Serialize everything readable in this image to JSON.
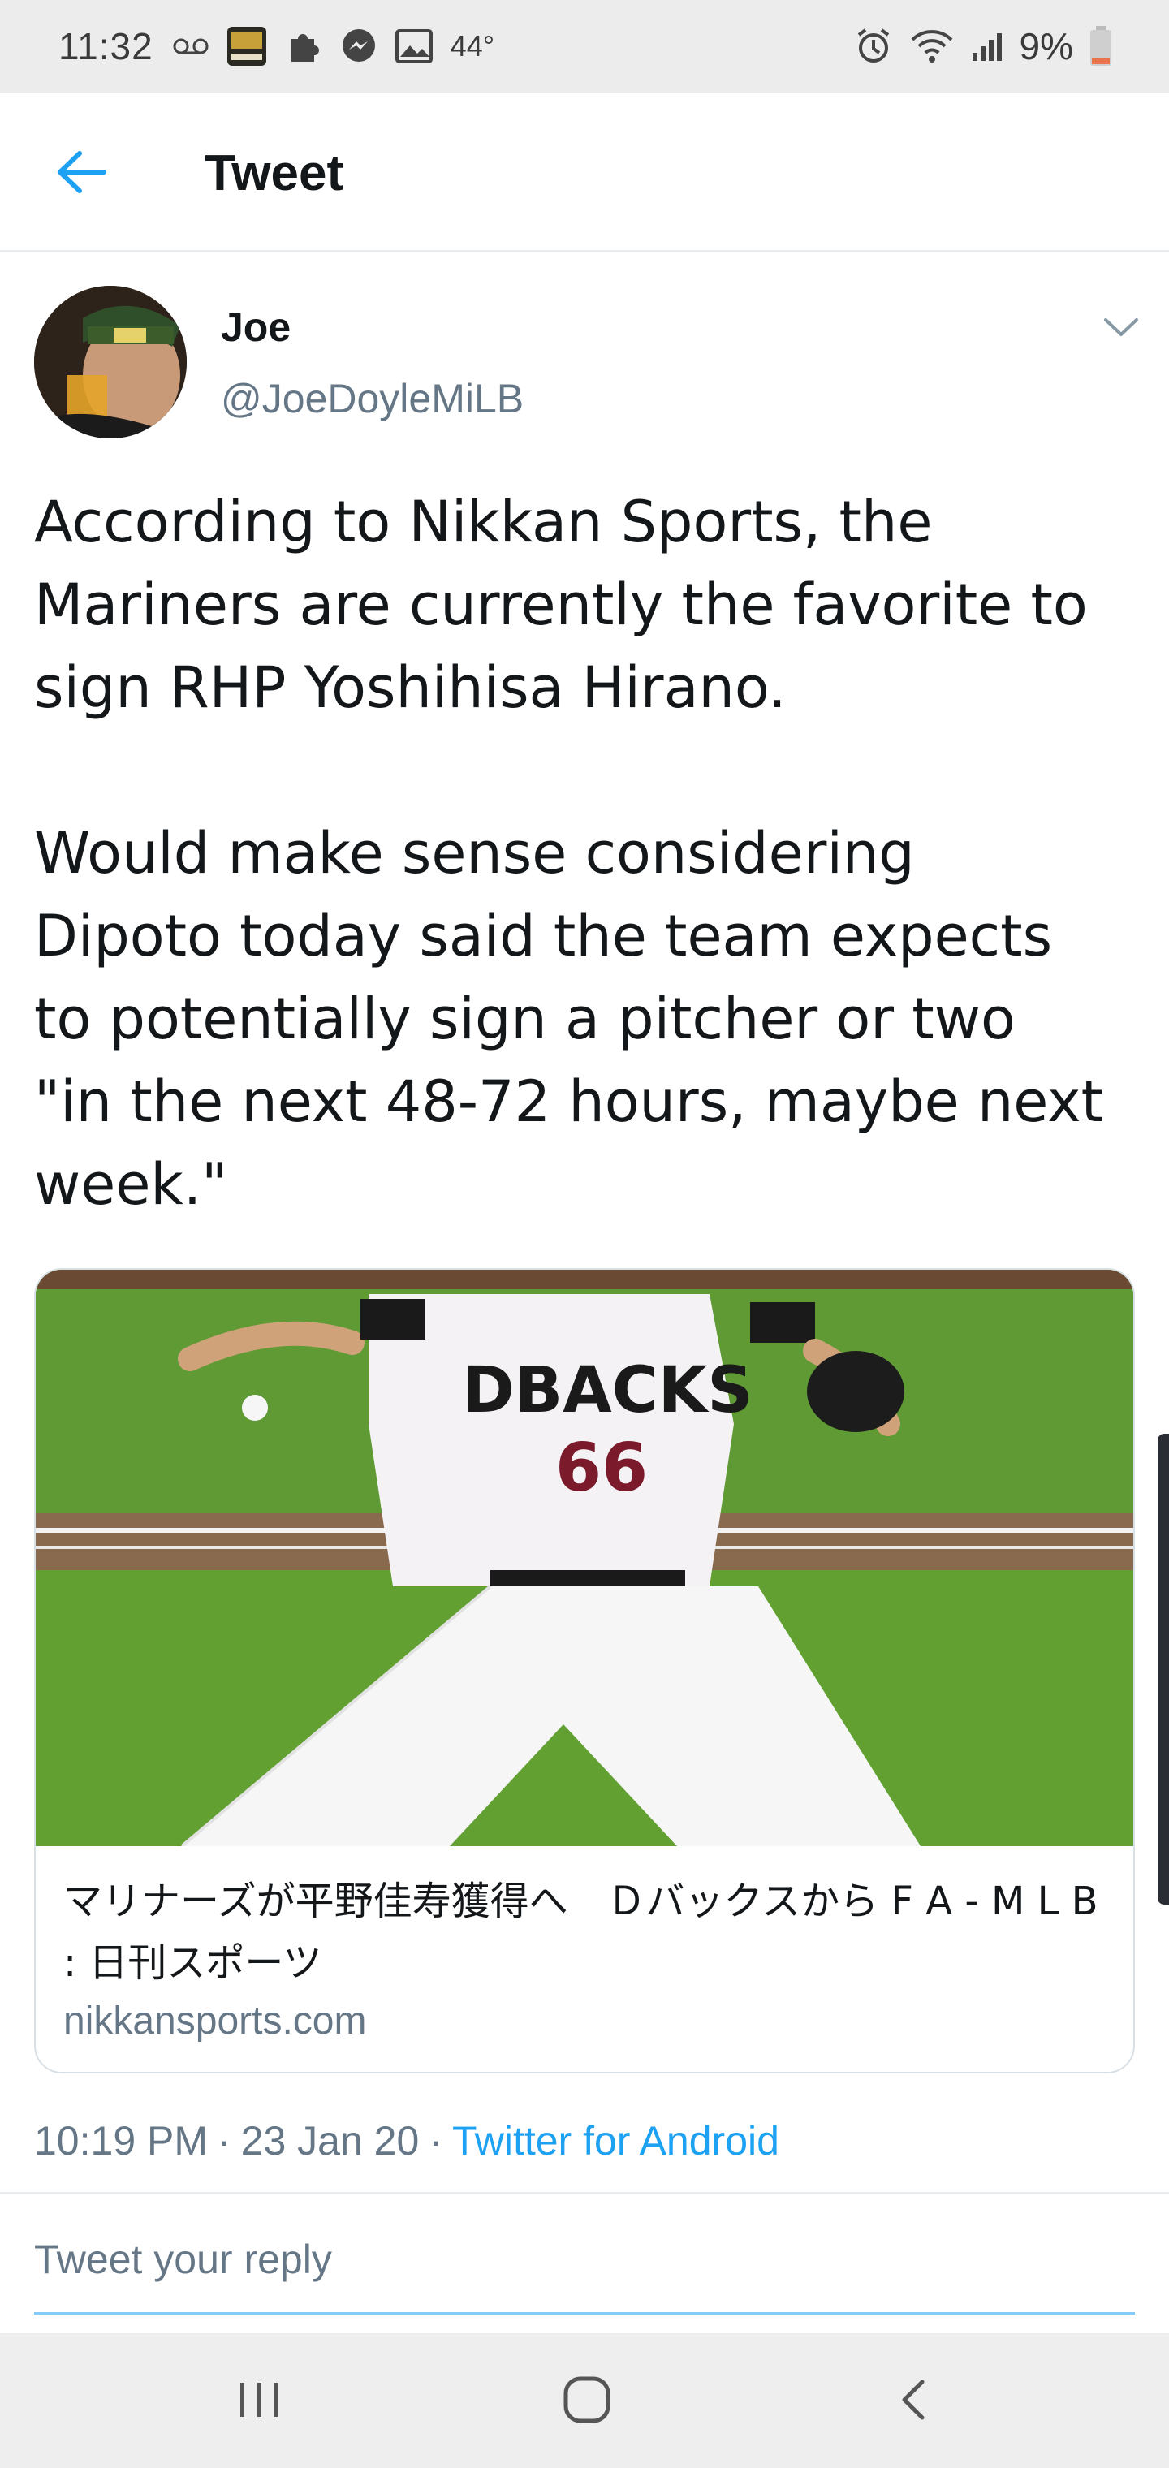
{
  "status_bar": {
    "time": "11:32",
    "temperature": "44°",
    "battery": "9%"
  },
  "header": {
    "title": "Tweet"
  },
  "tweet": {
    "author_name": "Joe",
    "author_handle": "@JoeDoyleMiLB",
    "text": "According to Nikkan Sports, the\nMariners are currently the favorite to\nsign RHP Yoshihisa Hirano.\n\nWould make sense considering\nDipoto today said the team expects\nto potentially sign a pitcher or two\n\"in the next 48-72 hours, maybe next\nweek.\"",
    "card": {
      "caption": "マリナーズが平野佳寿獲得へ　Ｄバックスから F A - M L B : 日刊スポーツ",
      "domain": "nikkansports.com",
      "image_jersey_text": "DBACKS",
      "image_jersey_number": "66"
    },
    "time": "10:19 PM",
    "date": "23 Jan 20",
    "separator": "·",
    "source": "Twitter for Android"
  },
  "reply": {
    "placeholder": "Tweet your reply"
  },
  "colors": {
    "accent": "#1da1f2",
    "secondary_text": "#657786",
    "primary_text": "#14171a"
  }
}
